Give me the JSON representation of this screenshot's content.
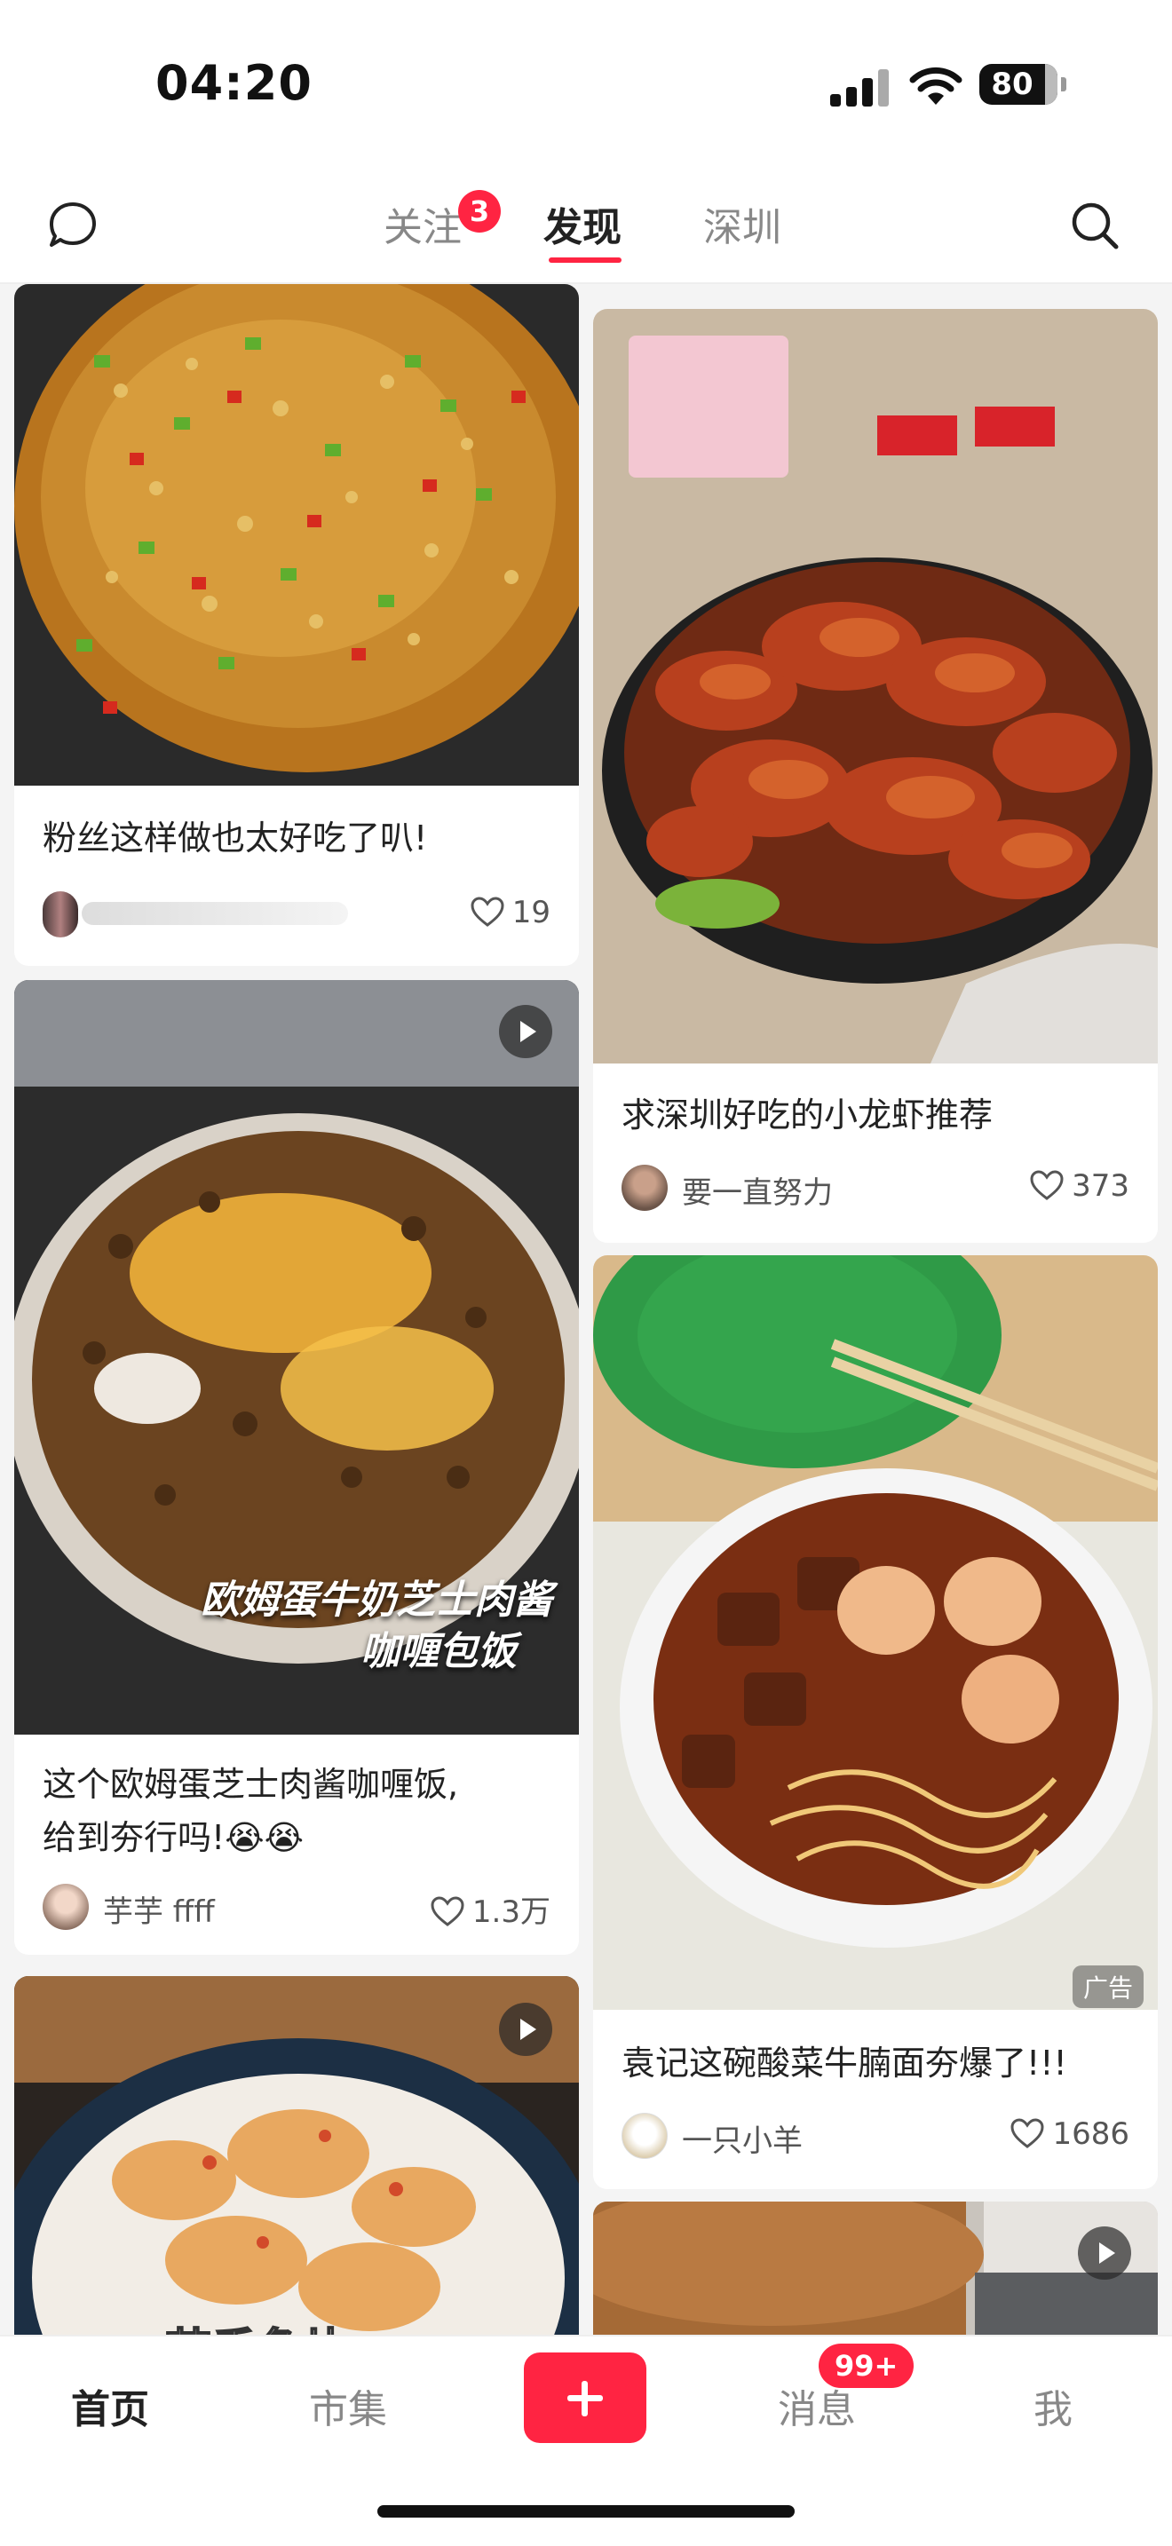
{
  "status_bar": {
    "time": "04:20",
    "battery": "80"
  },
  "top_nav": {
    "tabs": [
      {
        "label": "关注",
        "badge": "3"
      },
      {
        "label": "发现",
        "active": true
      },
      {
        "label": "深圳"
      }
    ],
    "left_icon": "chat-bubble-icon",
    "right_icon": "search-icon"
  },
  "feed": {
    "cards": [
      {
        "title": "粉丝这样做也太好吃了叭!",
        "author": "",
        "likes": "19"
      },
      {
        "title": "求深圳好吃的小龙虾推荐",
        "author": "要一直努力",
        "likes": "373"
      },
      {
        "title_line1": "这个欧姆蛋芝士肉酱咖喱饭,",
        "title_line2": "给到夯行吗!😭😭",
        "author": "芋芋 ffff",
        "likes": "1.3万",
        "overlay_line1": "欧姆蛋牛奶芝士肉酱",
        "overlay_line2": "咖喱包饭",
        "is_video": true
      },
      {
        "title": "袁记这碗酸菜牛腩面夯爆了!!!",
        "author": "一只小羊",
        "likes": "1686",
        "ad_label": "广告"
      },
      {
        "overlay": "苗香鱼片",
        "is_video": true
      },
      {
        "is_video": true
      }
    ]
  },
  "bottom_nav": {
    "items": [
      {
        "label": "首页",
        "active": true
      },
      {
        "label": "市集"
      },
      {
        "label": "消息",
        "badge": "99+"
      },
      {
        "label": "我"
      }
    ],
    "post_icon": "plus-icon"
  },
  "colors": {
    "accent": "#ff2442"
  }
}
